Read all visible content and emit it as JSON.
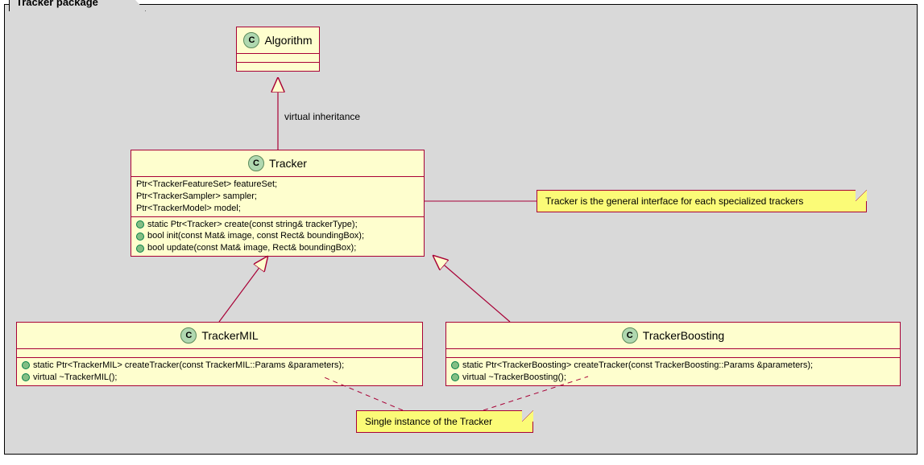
{
  "package": {
    "title": "Tracker package"
  },
  "algorithm": {
    "name": "Algorithm"
  },
  "tracker": {
    "name": "Tracker",
    "attrs": [
      "Ptr<TrackerFeatureSet> featureSet;",
      "Ptr<TrackerSampler> sampler;",
      "Ptr<TrackerModel> model;"
    ],
    "ops": [
      "static Ptr<Tracker> create(const string& trackerType);",
      "bool init(const Mat& image, const Rect& boundingBox);",
      "bool update(const Mat& image, Rect& boundingBox);"
    ]
  },
  "trackerMIL": {
    "name": "TrackerMIL",
    "ops": [
      "static Ptr<TrackerMIL> createTracker(const TrackerMIL::Params &parameters);",
      "virtual ~TrackerMIL();"
    ]
  },
  "trackerBoosting": {
    "name": "TrackerBoosting",
    "ops": [
      "static Ptr<TrackerBoosting> createTracker(const TrackerBoosting::Params &parameters);",
      "virtual ~TrackerBoosting();"
    ]
  },
  "notes": {
    "trackerNote": "Tracker is the general interface for each specialized trackers",
    "instanceNote": "Single instance of the Tracker"
  },
  "edges": {
    "virtualInheritance": "virtual inheritance"
  },
  "chart_data": {
    "type": "table",
    "description": "UML class diagram – Tracker package",
    "classes": [
      {
        "name": "Algorithm",
        "stereotype": "C",
        "attributes": [],
        "operations": []
      },
      {
        "name": "Tracker",
        "stereotype": "C",
        "attributes": [
          "Ptr<TrackerFeatureSet> featureSet;",
          "Ptr<TrackerSampler> sampler;",
          "Ptr<TrackerModel> model;"
        ],
        "operations": [
          "static Ptr<Tracker> create(const string& trackerType);",
          "bool init(const Mat& image, const Rect& boundingBox);",
          "bool update(const Mat& image, Rect& boundingBox);"
        ]
      },
      {
        "name": "TrackerMIL",
        "stereotype": "C",
        "attributes": [],
        "operations": [
          "static Ptr<TrackerMIL> createTracker(const TrackerMIL::Params &parameters);",
          "virtual ~TrackerMIL();"
        ]
      },
      {
        "name": "TrackerBoosting",
        "stereotype": "C",
        "attributes": [],
        "operations": [
          "static Ptr<TrackerBoosting> createTracker(const TrackerBoosting::Params &parameters);",
          "virtual ~TrackerBoosting();"
        ]
      }
    ],
    "relations": [
      {
        "from": "Tracker",
        "to": "Algorithm",
        "type": "generalization",
        "label": "virtual inheritance"
      },
      {
        "from": "TrackerMIL",
        "to": "Tracker",
        "type": "generalization"
      },
      {
        "from": "TrackerBoosting",
        "to": "Tracker",
        "type": "generalization"
      }
    ],
    "notes": [
      {
        "text": "Tracker is the general interface for each specialized trackers",
        "attachedTo": "Tracker"
      },
      {
        "text": "Single instance of the Tracker",
        "attachedTo": [
          "TrackerMIL",
          "TrackerBoosting"
        ]
      }
    ]
  }
}
